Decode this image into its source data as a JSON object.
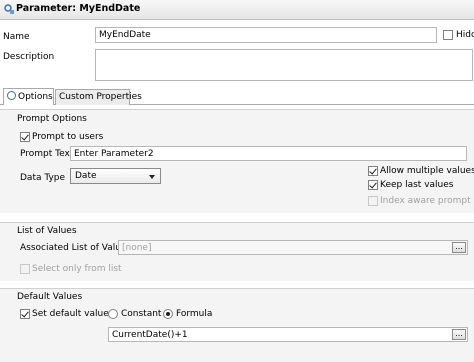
{
  "window": {
    "title": "Parameter: MyEndDate"
  },
  "fields": {
    "name_label": "Name",
    "name_value": "MyEndDate",
    "hidden_label": "Hidd",
    "description_label": "Description",
    "description_value": ""
  },
  "tabs": [
    {
      "label": "Options",
      "active": true
    },
    {
      "label": "Custom Properties",
      "active": false
    }
  ],
  "prompt_options": {
    "title": "Prompt Options",
    "prompt_to_users_label": "Prompt to users",
    "prompt_text_label": "Prompt Text",
    "prompt_text_value": "Enter Parameter2",
    "data_type_label": "Data Type",
    "data_type_value": "Date",
    "allow_multiple_label": "Allow multiple values",
    "keep_last_label": "Keep last values",
    "index_aware_label": "Index aware prompt"
  },
  "list_of_values": {
    "title": "List of Values",
    "associated_label": "Associated List of Values",
    "associated_placeholder": "[none]",
    "browse_label": "...",
    "select_only_label": "Select only from list"
  },
  "default_values": {
    "title": "Default Values",
    "set_default_label": "Set default values",
    "constant_label": "Constant",
    "formula_label": "Formula",
    "formula_value": "CurrentDate()+1",
    "browse_label": "..."
  },
  "colors": {
    "accent": "#3a6ea5",
    "group_bg": "#f4f4f4",
    "border": "#b7b7b7"
  }
}
